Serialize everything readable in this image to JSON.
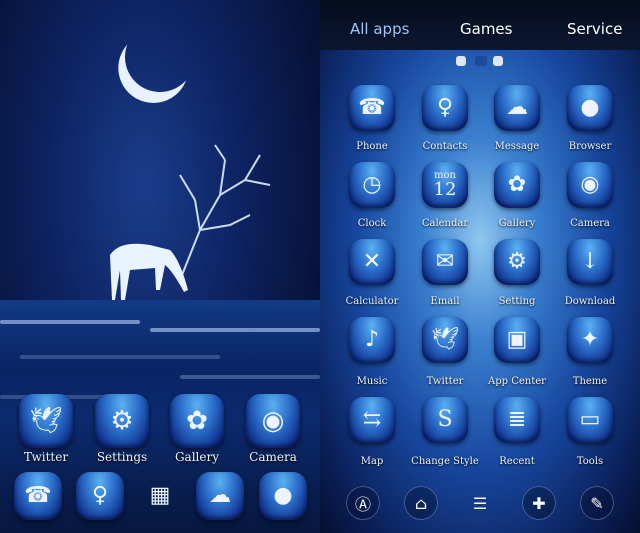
{
  "home": {
    "row1": [
      {
        "label": "Twitter",
        "icon": "twitter-bird-icon"
      },
      {
        "label": "Settings",
        "icon": "gear-flower-icon"
      },
      {
        "label": "Gallery",
        "icon": "daisy-icon"
      },
      {
        "label": "Camera",
        "icon": "owl-camera-icon"
      }
    ],
    "row2": [
      {
        "icon": "phone-icon"
      },
      {
        "icon": "contacts-fairy-icon"
      },
      {
        "icon": "app-drawer-icon"
      },
      {
        "icon": "message-tree-icon"
      },
      {
        "icon": "browser-moon-icon"
      }
    ]
  },
  "drawer": {
    "tabs": [
      {
        "label": "All apps",
        "active": true
      },
      {
        "label": "Games"
      },
      {
        "label": "Service"
      }
    ],
    "page_indicator": {
      "pages": 3,
      "current": 2
    },
    "apps": [
      {
        "label": "Phone",
        "icon": "phone-icon"
      },
      {
        "label": "Contacts",
        "icon": "contacts-fairy-icon"
      },
      {
        "label": "Message",
        "icon": "message-tree-icon"
      },
      {
        "label": "Browser",
        "icon": "browser-moon-icon"
      },
      {
        "label": "Clock",
        "icon": "clock-icon"
      },
      {
        "label": "Calendar",
        "icon": "calendar-icon",
        "day": "mon",
        "date": "12"
      },
      {
        "label": "Gallery",
        "icon": "daisy-icon"
      },
      {
        "label": "Camera",
        "icon": "owl-camera-icon"
      },
      {
        "label": "Calculator",
        "icon": "calculator-icon"
      },
      {
        "label": "Email",
        "icon": "envelope-icon"
      },
      {
        "label": "Setting",
        "icon": "gear-flower-icon"
      },
      {
        "label": "Download",
        "icon": "download-arrow-icon"
      },
      {
        "label": "Music",
        "icon": "music-lily-icon"
      },
      {
        "label": "Twitter",
        "icon": "twitter-bird-icon"
      },
      {
        "label": "App Center",
        "icon": "shopping-bag-icon"
      },
      {
        "label": "Theme",
        "icon": "theme-reindeer-icon"
      },
      {
        "label": "Map",
        "icon": "signpost-icon"
      },
      {
        "label": "Change Style",
        "icon": "style-s-icon"
      },
      {
        "label": "Recent",
        "icon": "scroll-icon"
      },
      {
        "label": "Tools",
        "icon": "toolbox-icon"
      }
    ],
    "dock": [
      {
        "icon": "search-a-icon"
      },
      {
        "icon": "android-store-icon"
      },
      {
        "icon": "menu-icon"
      },
      {
        "icon": "gamepad-icon"
      },
      {
        "icon": "broom-clean-icon"
      }
    ]
  },
  "colors": {
    "accent_tab": "#9fc6f0",
    "text": "#ffffff"
  }
}
